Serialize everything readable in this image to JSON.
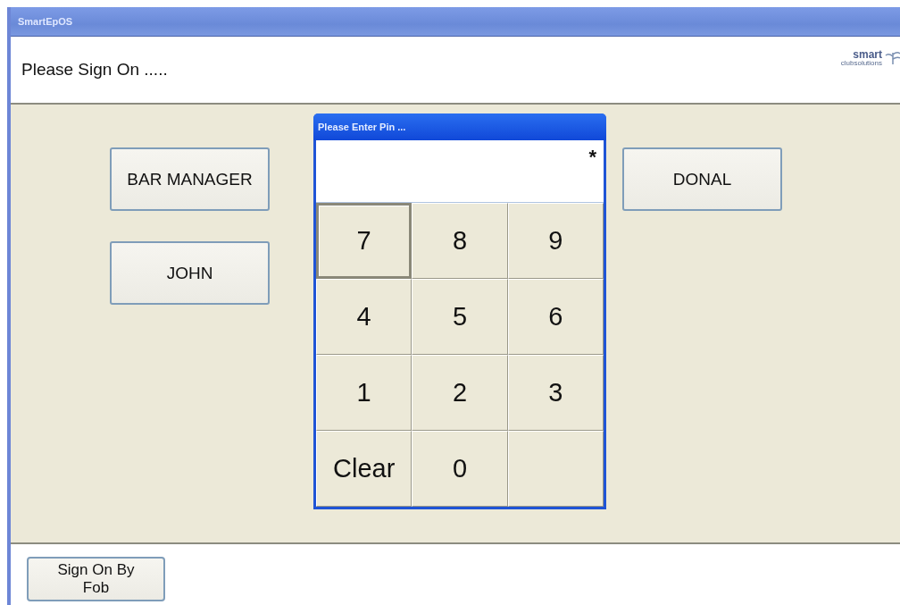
{
  "window": {
    "title": "SmartEpOS"
  },
  "header": {
    "prompt": "Please Sign On .....",
    "logo": {
      "name": "smart",
      "subtitle": "clubsolutions"
    }
  },
  "users_left": [
    {
      "label": "BAR MANAGER"
    },
    {
      "label": "JOHN"
    }
  ],
  "users_right": [
    {
      "label": "DONAL"
    }
  ],
  "pin_dialog": {
    "title": "Please Enter Pin ...",
    "display": "*",
    "keys": [
      {
        "kind": "key",
        "label": "7",
        "focused": true
      },
      {
        "kind": "key",
        "label": "8",
        "focused": false
      },
      {
        "kind": "key",
        "label": "9",
        "focused": false
      },
      {
        "kind": "key",
        "label": "4",
        "focused": false
      },
      {
        "kind": "key",
        "label": "5",
        "focused": false
      },
      {
        "kind": "key",
        "label": "6",
        "focused": false
      },
      {
        "kind": "key",
        "label": "1",
        "focused": false
      },
      {
        "kind": "key",
        "label": "2",
        "focused": false
      },
      {
        "kind": "key",
        "label": "3",
        "focused": false
      },
      {
        "kind": "key",
        "label": "Clear",
        "focused": false
      },
      {
        "kind": "key",
        "label": "0",
        "focused": false
      },
      {
        "kind": "blank",
        "focused": false
      }
    ]
  },
  "footer": {
    "button": "Sign On By Fob"
  }
}
